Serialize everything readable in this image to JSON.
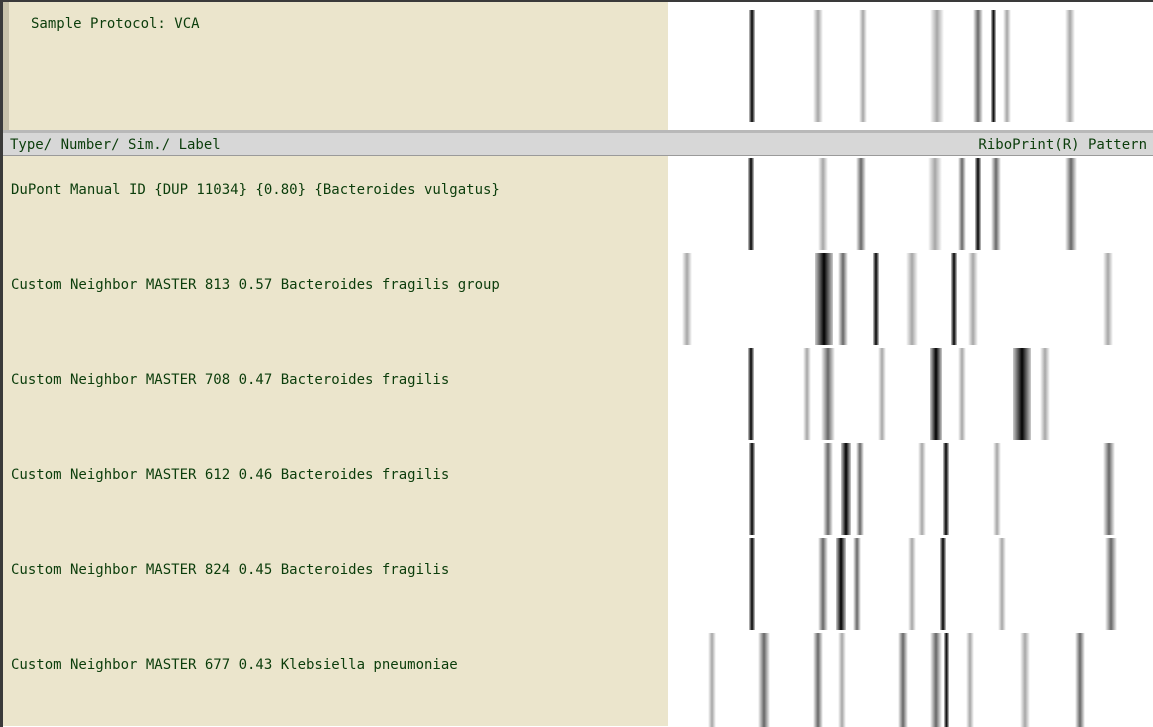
{
  "sample": {
    "protocol_label": "Sample Protocol: VCA"
  },
  "header": {
    "left_label": "Type/ Number/ Sim./ Label",
    "right_label": "RiboPrint(R) Pattern"
  },
  "rows": [
    {
      "label": "DuPont Manual ID {DUP 11034} {0.80} {Bacteroides vulgatus}"
    },
    {
      "label": "Custom Neighbor MASTER 813 0.57 Bacteroides fragilis group"
    },
    {
      "label": "Custom Neighbor MASTER 708 0.47 Bacteroides fragilis"
    },
    {
      "label": "Custom Neighbor MASTER 612 0.46 Bacteroides fragilis"
    },
    {
      "label": "Custom Neighbor MASTER 824 0.45 Bacteroides fragilis"
    },
    {
      "label": "Custom Neighbor MASTER 677 0.43 Klebsiella pneumoniae"
    }
  ],
  "colors": {
    "label_background": "#ebe5cc",
    "header_background": "#d7d7d7",
    "text": "#0b3d0b"
  }
}
